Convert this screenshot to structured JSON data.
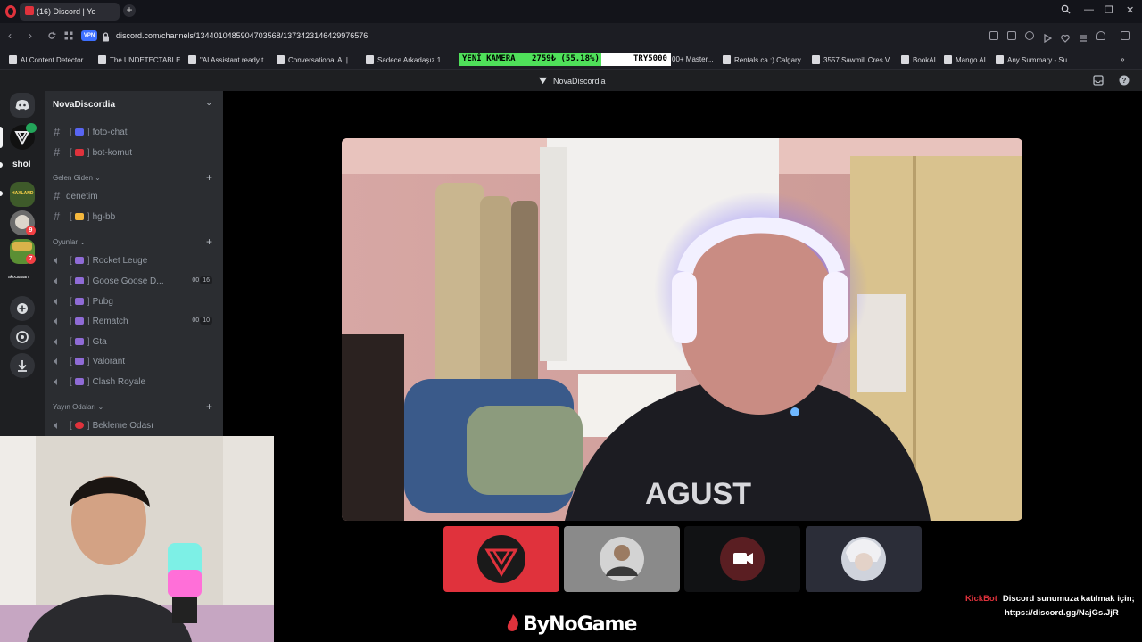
{
  "browser": {
    "tab_title": "(16) Discord | ",
    "tab_title_suffix": "Yo",
    "url": "discord.com/channels/1344010485904703568/1373423146429976576",
    "vpn_label": "VPN",
    "bookmarks": [
      "AI Content Detector...",
      "The UNDETECTABLE...",
      "\"AI Assistant ready t...",
      "Conversational AI |...",
      "Sadece Arkadaşız 1...",
      "00+ Master...",
      "Rentals.ca :) Calgary...",
      "3557 Sawmill Cres V...",
      "BookAI",
      "Mango AI",
      "Any Summary - Su..."
    ]
  },
  "ticker": {
    "label": "YENİ KAMERA",
    "amount": "2759₺ (55.18%)",
    "goal": "TRY5000"
  },
  "discord": {
    "header_title": "NovaDiscordia",
    "rail": {
      "short_label": "shol",
      "badges": [
        "9",
        "7"
      ],
      "dm_badge": ""
    },
    "server_name": "NovaDiscordia",
    "text_channels_top": [
      {
        "name": "foto-chat"
      },
      {
        "name": "bot-komut"
      }
    ],
    "category_gelen": "Gelen Giden",
    "gelen_channels": [
      {
        "name": "denetim"
      },
      {
        "name": "hg-bb"
      }
    ],
    "category_oyunlar": "Oyunlar",
    "voice_channels": [
      {
        "name": "Rocket Leuge",
        "count": "",
        "limit": ""
      },
      {
        "name": "Goose Goose D...",
        "count": "00",
        "limit": "16"
      },
      {
        "name": "Pubg",
        "count": "",
        "limit": ""
      },
      {
        "name": "Rematch",
        "count": "00",
        "limit": "10"
      },
      {
        "name": "Gta",
        "count": "",
        "limit": ""
      },
      {
        "name": "Valorant",
        "count": "",
        "limit": ""
      },
      {
        "name": "Clash Royale",
        "count": "",
        "limit": ""
      }
    ],
    "category_yayin": "Yayın Odaları",
    "yayin_channels": [
      {
        "name": "Bekleme Odası"
      }
    ]
  },
  "overlay": {
    "sponsor": "ByNoGame",
    "kick_user": "KickBot",
    "kick_message": "Discord sunumuza katılmak için;",
    "kick_link": "https://discord.gg/NajGs.JjR"
  },
  "colors": {
    "accent_red": "#e0323c",
    "ticker_green": "#4fe05a",
    "discord_bg": "#2b2d31"
  }
}
